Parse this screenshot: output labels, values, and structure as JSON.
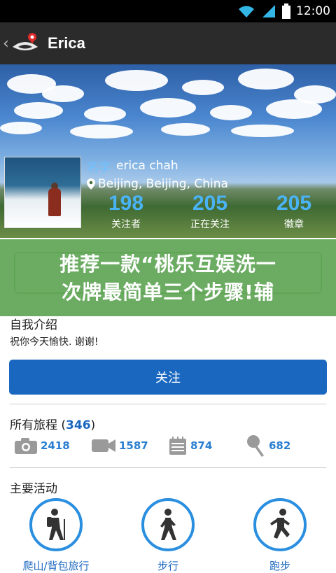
{
  "status": {
    "time": "12:00"
  },
  "appbar": {
    "back": "‹",
    "title": "Erica"
  },
  "profile": {
    "name_label": "名字",
    "name": "erica chah",
    "location": "Beijing, Beijing, China",
    "stats": [
      {
        "value": "198",
        "label": "关注者"
      },
      {
        "value": "205",
        "label": "正在关注"
      },
      {
        "value": "205",
        "label": "徽章"
      }
    ]
  },
  "overlay": {
    "line1": "推荐一款“桃乐互娱洗一",
    "line2": "次牌最简单三个步骤!辅"
  },
  "intro": {
    "title": "自我介绍",
    "text": "祝你今天愉快. 谢谢!"
  },
  "follow_button": "关注",
  "trips": {
    "title": "所有旅程",
    "count": "346",
    "items": [
      {
        "icon": "camera-icon",
        "value": "2418"
      },
      {
        "icon": "video-icon",
        "value": "1587"
      },
      {
        "icon": "notepad-icon",
        "value": "874"
      },
      {
        "icon": "microphone-icon",
        "value": "682"
      }
    ]
  },
  "activities": {
    "title": "主要活动",
    "items": [
      {
        "icon": "hiking-icon",
        "label": "爬山/背包旅行"
      },
      {
        "icon": "walking-icon",
        "label": "步行"
      },
      {
        "icon": "running-icon",
        "label": "跑步"
      }
    ]
  },
  "colors": {
    "accent": "#1a67c0",
    "stat_blue": "#4ab3f5",
    "overlay_green": "#56a04c"
  }
}
